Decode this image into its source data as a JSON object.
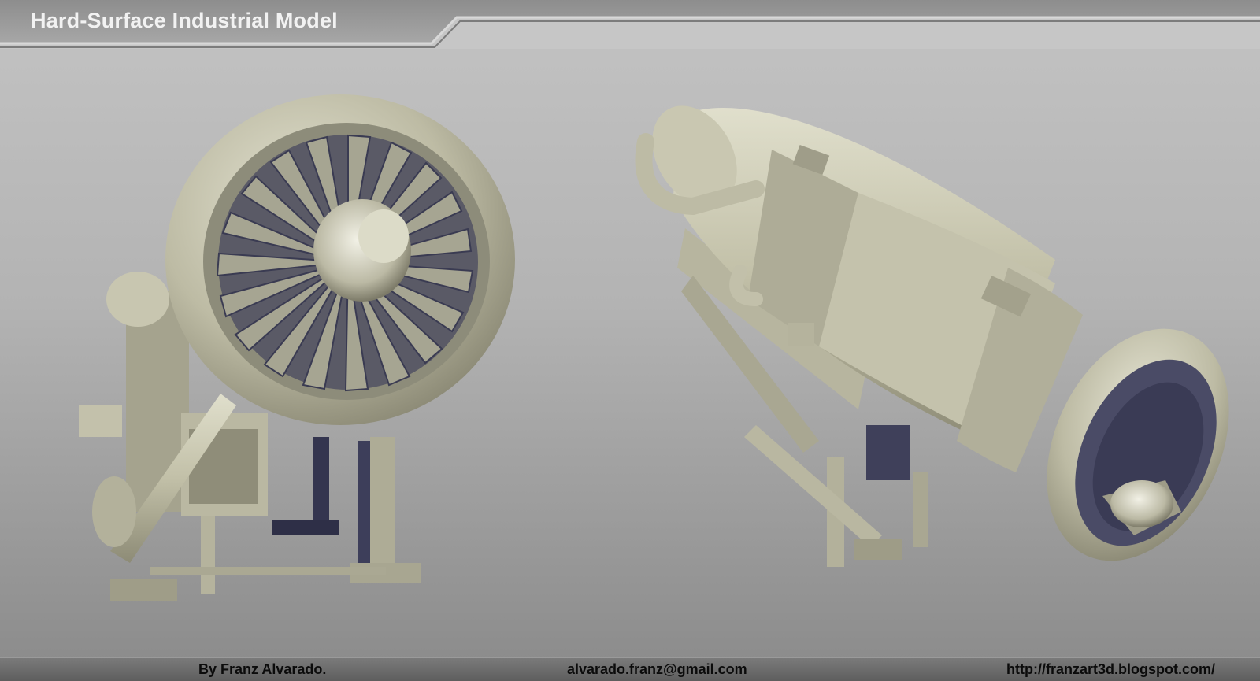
{
  "title": "Hard-Surface Industrial Model",
  "footer": {
    "author": "By Franz Alvarado.",
    "email": "alvarado.franz@gmail.com",
    "url": "http://franzart3d.blogspot.com/"
  },
  "colors": {
    "metal": "#c8c6b0",
    "shadow": "#3c3d58",
    "title": "#f2f2f2",
    "footer_bg": "#6a6a6a"
  }
}
